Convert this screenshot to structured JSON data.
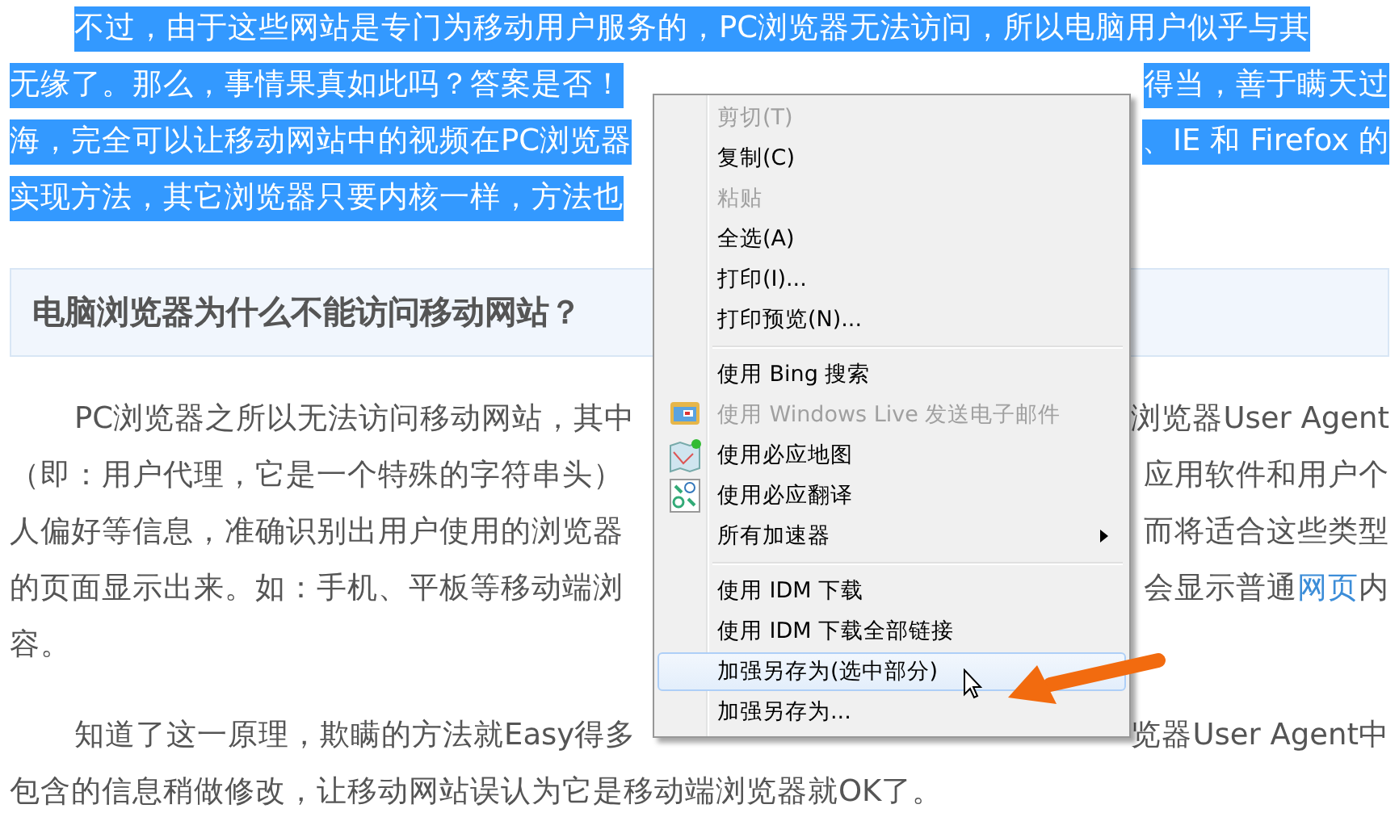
{
  "article": {
    "blocks": [
      {
        "kind": "paragraph",
        "selected": true,
        "lines": [
          {
            "left": [
              {
                "text": "不过，由于这些网站是专门为移动用户服务的，PC浏览器无法访问，所以电脑用户似乎与其",
                "link": false
              }
            ]
          },
          {
            "left": [
              {
                "text": "无缘了。那么，事情果真如此吗？答案是否！",
                "link": false
              }
            ],
            "right": [
              {
                "text": "得当，善于瞒天过",
                "link": false
              }
            ]
          },
          {
            "left": [
              {
                "text": "海，完全可以让移动网站中的视频在PC浏览器",
                "link": false
              }
            ],
            "right": [
              {
                "text": "、IE 和 Firefox 的",
                "link": false
              }
            ]
          },
          {
            "left": [
              {
                "text": "实现方法，其它浏览器只要内核一样，方法也",
                "link": false
              }
            ]
          }
        ]
      },
      {
        "kind": "heading",
        "text": "电脑浏览器为什么不能访问移动网站？"
      },
      {
        "kind": "paragraph",
        "selected": false,
        "lines": [
          {
            "left": [
              {
                "text": "PC浏览器之所以无法访问移动网站，其中",
                "link": false
              }
            ],
            "right": [
              {
                "text": "浏览器User Agent",
                "link": false
              }
            ]
          },
          {
            "left": [
              {
                "text": "（即：用户代理，它是一个特殊的字符串头）",
                "link": false
              }
            ],
            "right": [
              {
                "text": "应用软件和用户个",
                "link": false
              }
            ]
          },
          {
            "left": [
              {
                "text": "人偏好等信息，准确识别出用户使用的浏览器",
                "link": false
              }
            ],
            "right": [
              {
                "text": "而将适合这些类型",
                "link": false
              }
            ]
          },
          {
            "left": [
              {
                "text": "的页面显示出来。如：手机、平板等移动端浏",
                "link": false
              }
            ],
            "right": [
              {
                "text": "会显示普通",
                "link": false
              },
              {
                "text": "网页",
                "link": true
              },
              {
                "text": "内",
                "link": false
              }
            ]
          },
          {
            "left": [
              {
                "text": "容。",
                "link": false
              }
            ]
          }
        ]
      },
      {
        "kind": "paragraph",
        "selected": false,
        "lines": [
          {
            "left": [
              {
                "text": "知道了这一原理，欺瞒的方法就Easy得多",
                "link": false
              }
            ],
            "right": [
              {
                "text": "览器User Agent中",
                "link": false
              }
            ]
          },
          {
            "left": [
              {
                "text": "包含的信息稍做修改，让移动网站误认为它是移动端浏览器就OK了。",
                "link": false
              }
            ]
          }
        ]
      }
    ]
  },
  "context_menu": {
    "items": [
      {
        "kind": "item",
        "label": "剪切(T)",
        "disabled": true,
        "selected": false
      },
      {
        "kind": "item",
        "label": "复制(C)",
        "disabled": false,
        "selected": false
      },
      {
        "kind": "item",
        "label": "粘贴",
        "disabled": true,
        "selected": false
      },
      {
        "kind": "item",
        "label": "全选(A)",
        "disabled": false,
        "selected": false
      },
      {
        "kind": "item",
        "label": "打印(I)...",
        "disabled": false,
        "selected": false
      },
      {
        "kind": "item",
        "label": "打印预览(N)...",
        "disabled": false,
        "selected": false
      },
      {
        "kind": "separator"
      },
      {
        "kind": "item",
        "label": "使用 Bing 搜索",
        "disabled": false,
        "selected": false
      },
      {
        "kind": "mail",
        "label": "使用 Windows Live 发送电子邮件",
        "disabled": true,
        "selected": false
      },
      {
        "kind": "map",
        "label": "使用必应地图",
        "disabled": false,
        "selected": false
      },
      {
        "kind": "translate",
        "label": "使用必应翻译",
        "disabled": false,
        "selected": false
      },
      {
        "kind": "submenu",
        "label": "所有加速器",
        "disabled": false,
        "selected": false
      },
      {
        "kind": "separator"
      },
      {
        "kind": "item",
        "label": "使用 IDM 下载",
        "disabled": false,
        "selected": false
      },
      {
        "kind": "item",
        "label": "使用 IDM 下载全部链接",
        "disabled": false,
        "selected": false
      },
      {
        "kind": "item",
        "label": "加强另存为(选中部分)",
        "disabled": false,
        "selected": true
      },
      {
        "kind": "item",
        "label": "加强另存为...",
        "disabled": false,
        "selected": false
      }
    ]
  }
}
